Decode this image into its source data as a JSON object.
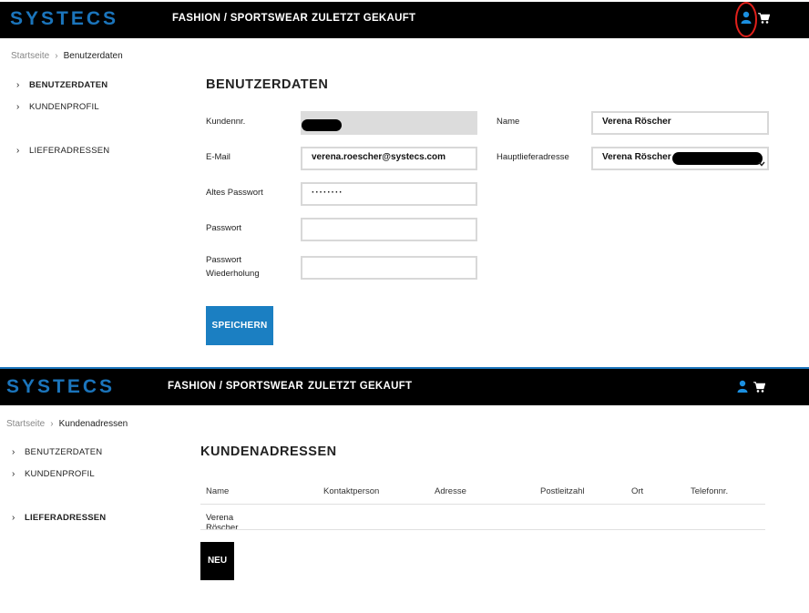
{
  "header": {
    "logo": "SYSTECS",
    "nav": [
      "FASHION / SPORTSWEAR",
      "ZULETZT GEKAUFT"
    ],
    "icons": [
      "user-icon",
      "cart-icon"
    ],
    "accent": "#1b75bc",
    "highlight": "#e0201b"
  },
  "screen1": {
    "breadcrumb": {
      "home": "Startseite",
      "separator": "›",
      "current": "Benutzerdaten"
    },
    "sidebar": [
      {
        "label": "BENUTZERDATEN",
        "active": true
      },
      {
        "label": "KUNDENPROFIL",
        "active": false
      },
      {
        "label": "LIEFERADRESSEN",
        "active": false
      }
    ],
    "title": "BENUTZERDATEN",
    "fields": {
      "kundennr": {
        "label": "Kundennr.",
        "value": ""
      },
      "email": {
        "label": "E-Mail",
        "value": "verena.roescher@systecs.com"
      },
      "altes_passwort": {
        "label": "Altes Passwort",
        "value": "········"
      },
      "passwort": {
        "label": "Passwort",
        "value": ""
      },
      "passwort_wdh": {
        "label": "Passwort\nWiederholung",
        "value": ""
      },
      "name": {
        "label": "Name",
        "value": "Verena Röscher"
      },
      "hauptlieferadresse": {
        "label": "Hauptlieferadresse",
        "value": "Verena Röscher"
      }
    },
    "save_label": "SPEICHERN",
    "button_color": "#1b7fc2"
  },
  "screen2": {
    "breadcrumb": {
      "home": "Startseite",
      "separator": "›",
      "current": "Kundenadressen"
    },
    "sidebar": [
      {
        "label": "BENUTZERDATEN",
        "active": false
      },
      {
        "label": "KUNDENPROFIL",
        "active": false
      },
      {
        "label": "LIEFERADRESSEN",
        "active": true
      }
    ],
    "title": "KUNDENADRESSEN",
    "table": {
      "columns": [
        "Name",
        "Kontaktperson",
        "Adresse",
        "Postleitzahl",
        "Ort",
        "Telefonnr."
      ],
      "rows": [
        [
          "Verena Röscher",
          "",
          "",
          "",
          "",
          ""
        ]
      ]
    },
    "new_label": "NEU"
  }
}
